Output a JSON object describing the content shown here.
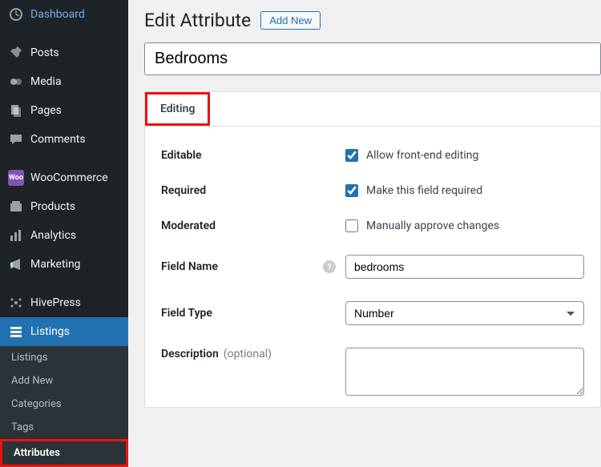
{
  "sidebar": {
    "items": [
      {
        "label": "Dashboard"
      },
      {
        "label": "Posts"
      },
      {
        "label": "Media"
      },
      {
        "label": "Pages"
      },
      {
        "label": "Comments"
      },
      {
        "label": "WooCommerce"
      },
      {
        "label": "Products"
      },
      {
        "label": "Analytics"
      },
      {
        "label": "Marketing"
      },
      {
        "label": "HivePress"
      },
      {
        "label": "Listings"
      }
    ],
    "submenu": [
      {
        "label": "Listings"
      },
      {
        "label": "Add New"
      },
      {
        "label": "Categories"
      },
      {
        "label": "Tags"
      },
      {
        "label": "Attributes"
      }
    ]
  },
  "page": {
    "title": "Edit Attribute",
    "add_new": "Add New",
    "name_value": "Bedrooms"
  },
  "tabs": {
    "editing": "Editing"
  },
  "fields": {
    "editable": {
      "label": "Editable",
      "checkbox_label": "Allow front-end editing",
      "checked": true
    },
    "required": {
      "label": "Required",
      "checkbox_label": "Make this field required",
      "checked": true
    },
    "moderated": {
      "label": "Moderated",
      "checkbox_label": "Manually approve changes",
      "checked": false
    },
    "field_name": {
      "label": "Field Name",
      "value": "bedrooms"
    },
    "field_type": {
      "label": "Field Type",
      "value": "Number"
    },
    "description": {
      "label": "Description",
      "optional": "(optional)",
      "value": ""
    }
  }
}
